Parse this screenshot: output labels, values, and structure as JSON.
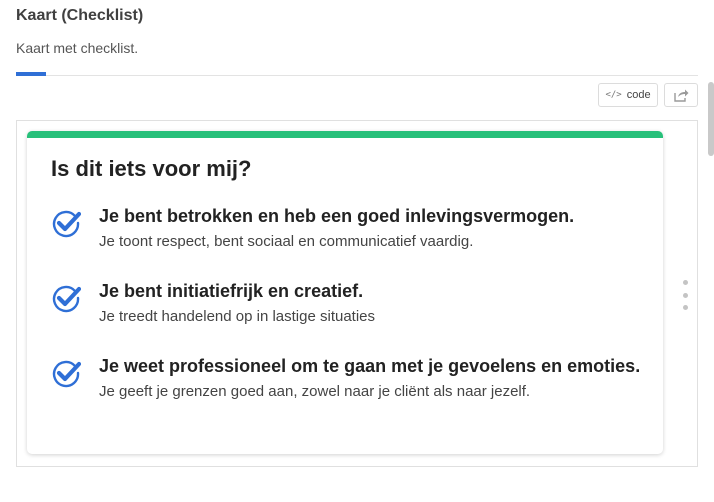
{
  "header": {
    "title": "Kaart (Checklist)",
    "subtitle": "Kaart met checklist."
  },
  "toolbar": {
    "code_glyph": "</>",
    "code_label": "code",
    "share_icon": "share-icon"
  },
  "card": {
    "accent_color": "#27c07a",
    "check_color": "#2f6fd6",
    "title": "Is dit iets voor mij?",
    "items": [
      {
        "icon": "check-circle-icon",
        "heading": "Je bent betrokken en heb een goed inlevingsvermogen.",
        "description": "Je toont respect, bent sociaal en communicatief vaardig."
      },
      {
        "icon": "check-circle-icon",
        "heading": "Je bent initiatiefrijk en creatief.",
        "description": "Je treedt handelend op in lastige situaties"
      },
      {
        "icon": "check-circle-icon",
        "heading": "Je weet professioneel om te gaan met je gevoelens en emoties.",
        "description": "Je geeft je grenzen goed aan, zowel naar je cliënt als naar jezelf."
      }
    ]
  }
}
